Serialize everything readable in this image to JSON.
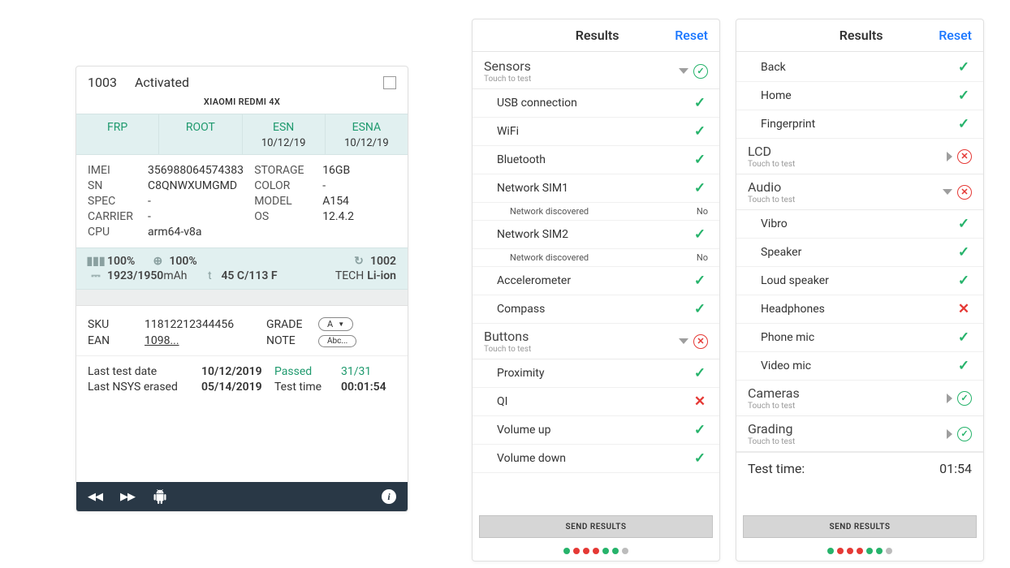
{
  "left": {
    "id": "1003",
    "status": "Activated",
    "model": "XIAOMI REDMI 4X",
    "teal": [
      {
        "label": "FRP",
        "sub": ""
      },
      {
        "label": "ROOT",
        "sub": ""
      },
      {
        "label": "ESN",
        "sub": "10/12/19"
      },
      {
        "label": "ESNA",
        "sub": "10/12/19"
      }
    ],
    "info": {
      "imei_l": "IMEI",
      "imei_v": "356988064574383",
      "sn_l": "SN",
      "sn_v": "C8QNWXUMGMD",
      "spec_l": "SPEC",
      "spec_v": "-",
      "carrier_l": "CARRIER",
      "carrier_v": "-",
      "cpu_l": "CPU",
      "cpu_v": "arm64-v8a",
      "storage_l": "STORAGE",
      "storage_v": "16GB",
      "color_l": "COLOR",
      "color_v": "-",
      "modelcode_l": "MODEL",
      "modelcode_v": "A154",
      "os_l": "OS",
      "os_v": "12.4.2"
    },
    "battery": {
      "pct1": "100%",
      "pct2": "100%",
      "counter": "1002",
      "mah": "1923/1950",
      "mah_unit": "mAh",
      "temp_prefix": "t",
      "temp": "45 C/113 F",
      "tech_l": "TECH",
      "tech_v": "Li-ion"
    },
    "sku": {
      "sku_l": "SKU",
      "sku_v": "11812212344456",
      "ean_l": "EAN",
      "ean_v": "1098...",
      "grade_l": "GRADE",
      "grade_v": "A",
      "note_l": "NOTE",
      "note_v": "Abc..."
    },
    "tests": {
      "last_test_l": "Last test date",
      "last_test_v": "10/12/2019",
      "passed_l": "Passed",
      "passed_v": "31/31",
      "erased_l": "Last NSYS erased",
      "erased_v": "05/14/2019",
      "testtime_l": "Test time",
      "testtime_v": "00:01:54"
    }
  },
  "rheader": {
    "title": "Results",
    "reset": "Reset"
  },
  "touch_to_test": "Touch to test",
  "send": "SEND RESULTS",
  "mid": {
    "sensors_label": "Sensors",
    "buttons_label": "Buttons",
    "items_s": [
      {
        "label": "USB connection",
        "ok": true
      },
      {
        "label": "WiFi",
        "ok": true
      },
      {
        "label": "Bluetooth",
        "ok": true
      },
      {
        "label": "Network SIM1",
        "ok": true,
        "sub": {
          "label": "Network discovered",
          "val": "No"
        }
      },
      {
        "label": "Network SIM2",
        "ok": true,
        "sub": {
          "label": "Network discovered",
          "val": "No"
        }
      },
      {
        "label": "Accelerometer",
        "ok": true
      },
      {
        "label": "Compass",
        "ok": true
      }
    ],
    "items_b": [
      {
        "label": "Proximity",
        "ok": true
      },
      {
        "label": "QI",
        "ok": false
      },
      {
        "label": "Volume up",
        "ok": true
      },
      {
        "label": "Volume down",
        "ok": true
      }
    ]
  },
  "right": {
    "top_items": [
      {
        "label": "Back",
        "ok": true
      },
      {
        "label": "Home",
        "ok": true
      },
      {
        "label": "Fingerprint",
        "ok": true
      }
    ],
    "lcd_label": "LCD",
    "audio_label": "Audio",
    "audio_items": [
      {
        "label": "Vibro",
        "ok": true
      },
      {
        "label": "Speaker",
        "ok": true
      },
      {
        "label": "Loud speaker",
        "ok": true
      },
      {
        "label": "Headphones",
        "ok": false
      },
      {
        "label": "Phone mic",
        "ok": true
      },
      {
        "label": "Video mic",
        "ok": true
      }
    ],
    "cameras_label": "Cameras",
    "grading_label": "Grading",
    "testtime_l": "Test time:",
    "testtime_v": "01:54"
  },
  "dots": [
    "g",
    "r",
    "r",
    "r",
    "g",
    "g",
    "grey"
  ]
}
